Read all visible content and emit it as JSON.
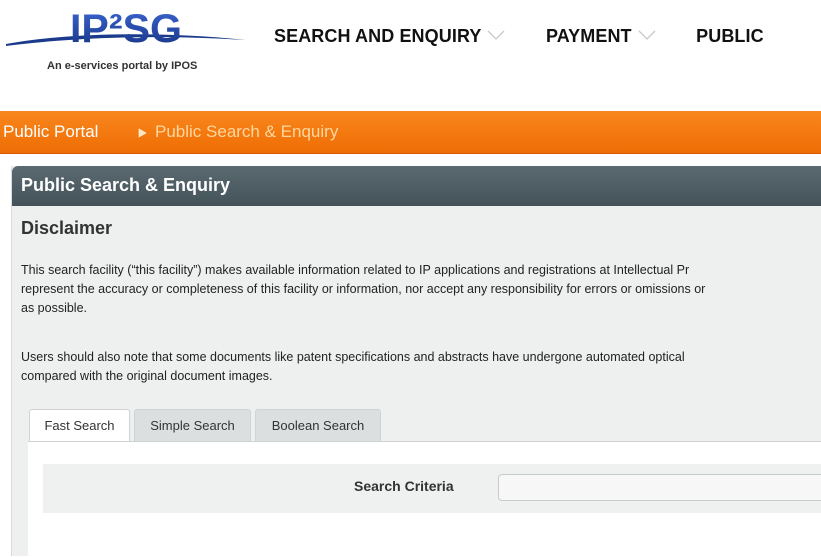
{
  "header": {
    "logo_text": "IP²SG",
    "tagline": "An e-services portal by IPOS",
    "nav": [
      {
        "label": "SEARCH AND ENQUIRY"
      },
      {
        "label": "PAYMENT"
      },
      {
        "label": "PUBLIC"
      }
    ]
  },
  "breadcrumb": {
    "root": "Public Portal",
    "current": "Public Search & Enquiry"
  },
  "panel": {
    "title": "Public Search & Enquiry",
    "disclaimer_title": "Disclaimer",
    "paragraph1": [
      "This search facility (“this facility”) makes available information related to IP applications and registrations at Intellectual Pr",
      "represent the accuracy or completeness of this facility or information, nor accept any responsibility for errors or omissions or",
      "as possible."
    ],
    "paragraph2": [
      "Users should also note that some documents like patent specifications and abstracts have undergone automated optical",
      "compared with the original document images."
    ]
  },
  "tabs": [
    {
      "label": "Fast Search",
      "active": true
    },
    {
      "label": "Simple Search",
      "active": false
    },
    {
      "label": "Boolean Search",
      "active": false
    }
  ],
  "search": {
    "criteria_label": "Search Criteria",
    "criteria_value": ""
  },
  "colors": {
    "brand_blue": "#1a3a8c",
    "orange_bar": "#f47a10",
    "panel_header": "#4b5a61"
  }
}
